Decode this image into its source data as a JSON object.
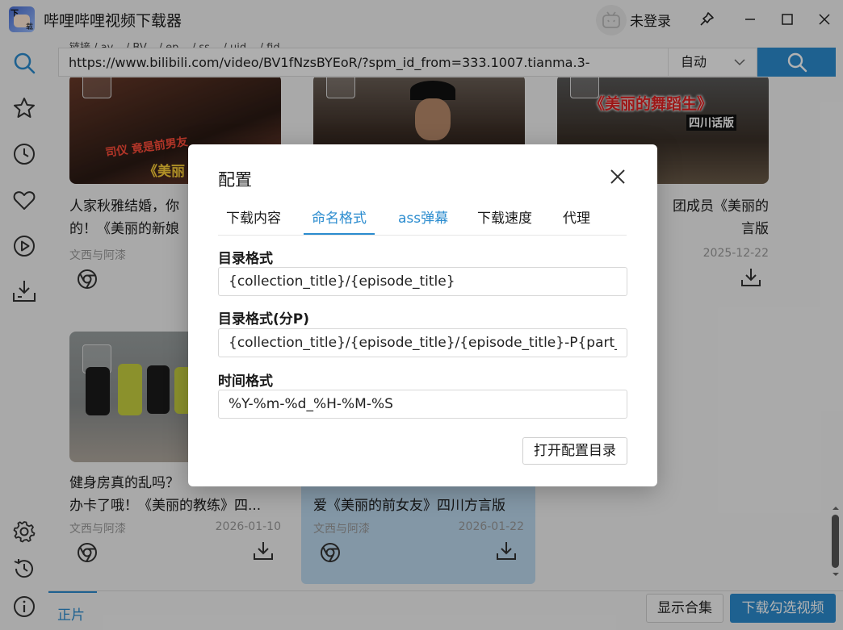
{
  "app": {
    "title": "哔哩哔哩视频下载器",
    "icon_text_top": "下",
    "icon_text_bottom": "载",
    "login_status": "未登录"
  },
  "url_bar": {
    "breadcrumbs": "链接 / av... / BV... / ep... / ss... / uid... / fid...",
    "url": "https://www.bilibili.com/video/BV1fNzsBYEoR/?spm_id_from=333.1007.tianma.3-",
    "mode": "自动"
  },
  "cards": [
    {
      "title": "人家秋雅结婚，你这当司仪的在干什么？抢新娘的！《美丽的新娘》四川方言版",
      "visible_title": "人家秋雅结婚，你\n的！《美丽的新娘",
      "author": "文西与阿漆",
      "date": "",
      "thumb_text": "司仪 竟是前男友",
      "thumb_subtext": "《美丽",
      "selected": false
    },
    {
      "title": "",
      "visible_title": "",
      "author": "",
      "date": "",
      "thumb_text": "",
      "thumb_subtext": "",
      "selected": false
    },
    {
      "title": "团成员《美丽的言版",
      "visible_title": "团成员《美丽的\n言版",
      "author": "",
      "date": "2025-12-22",
      "thumb_text": "《美丽的舞蹈生》",
      "thumb_subtext": "四川话版",
      "selected": false
    },
    {
      "title": "健身房真的乱吗？…办卡了哦！《美丽的教练》四…",
      "visible_title": "健身房真的乱吗？\n办卡了哦！《美丽的教练》四...",
      "author": "文西与阿漆",
      "date": "2026-01-10",
      "thumb_text": "",
      "thumb_subtext": "",
      "selected": false
    },
    {
      "title": "爱《美丽的前女友》四川方言版",
      "visible_title": "\n爱《美丽的前女友》四川方言版",
      "author": "文西与阿漆",
      "date": "2026-01-22",
      "thumb_text": "",
      "thumb_subtext": "",
      "selected": true
    }
  ],
  "bottom": {
    "tab_label": "正片",
    "show_collection": "显示合集",
    "download_selected": "下载勾选视频"
  },
  "modal": {
    "title": "配置",
    "tabs": [
      "下载内容",
      "命名格式",
      "ass弹幕",
      "下载速度",
      "代理"
    ],
    "active_tab": "命名格式",
    "fields": [
      {
        "label": "目录格式",
        "value": "{collection_title}/{episode_title}"
      },
      {
        "label": "目录格式(分P)",
        "value": "{collection_title}/{episode_title}/{episode_title}-P{part_o"
      },
      {
        "label": "时间格式",
        "value": "%Y-%m-%d_%H-%M-%S"
      }
    ],
    "open_config_dir": "打开配置目录"
  },
  "colors": {
    "accent": "#2b8ccf",
    "selected_card": "#bcd8ee"
  }
}
